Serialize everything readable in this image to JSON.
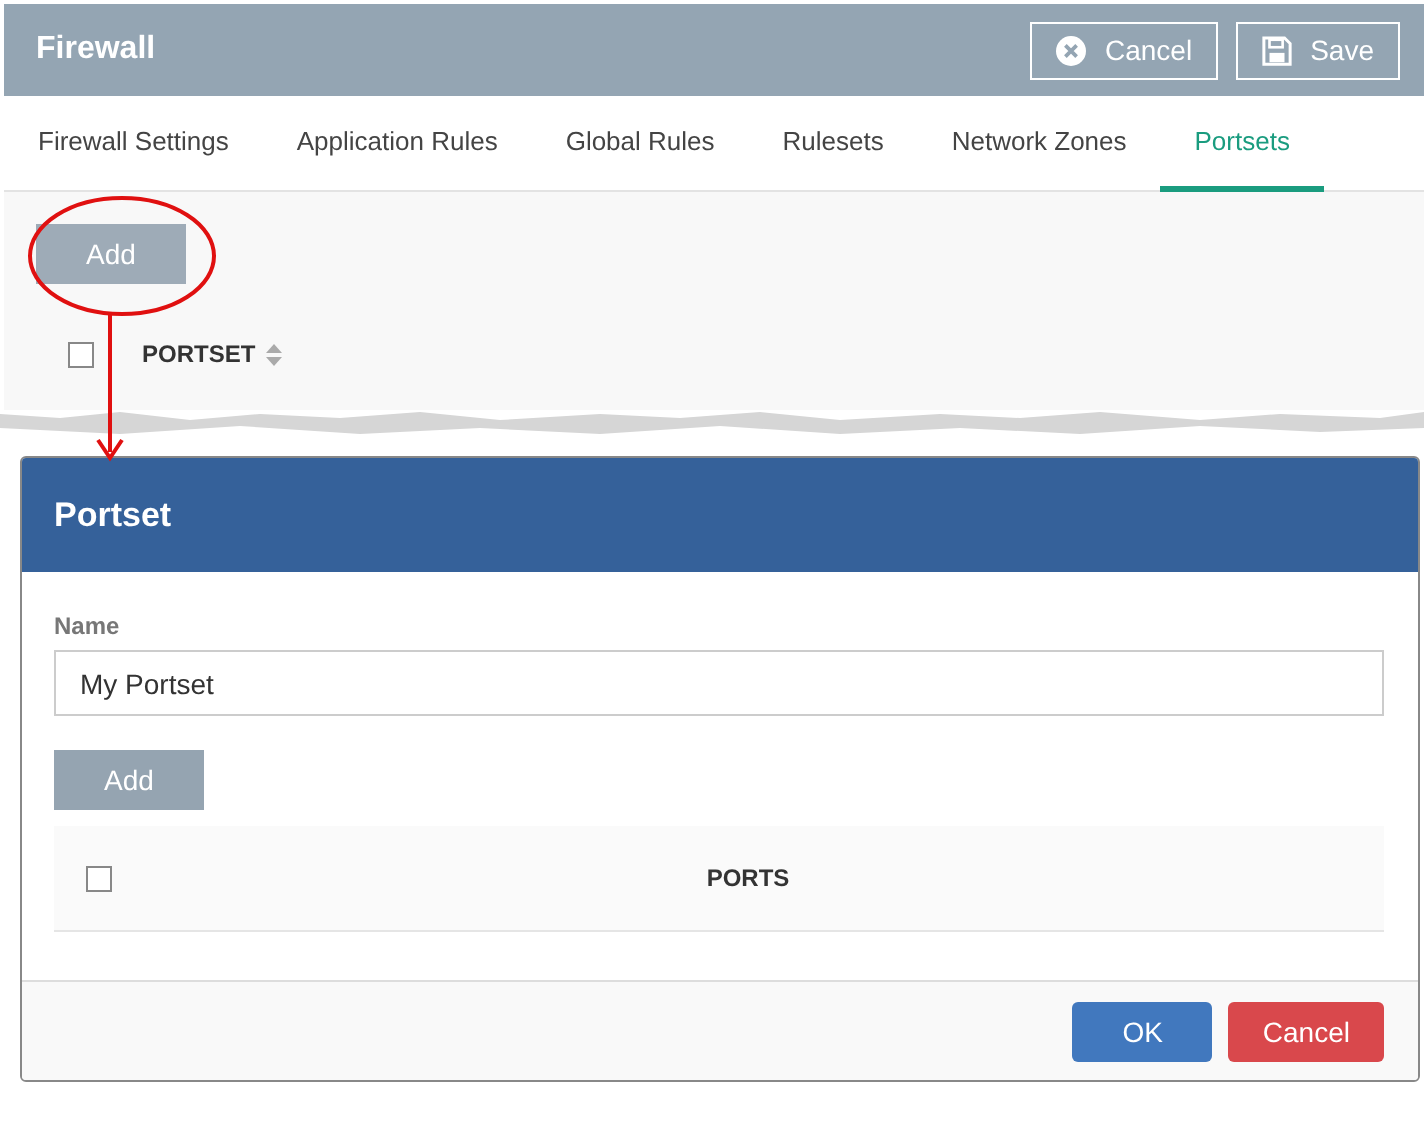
{
  "window": {
    "title": "Firewall"
  },
  "header_buttons": [
    {
      "label": "Cancel",
      "kind": "cancel"
    },
    {
      "label": "Save",
      "kind": "save"
    }
  ],
  "tabs": [
    {
      "label": "Firewall Settings",
      "selected": false
    },
    {
      "label": "Application Rules",
      "selected": false
    },
    {
      "label": "Global Rules",
      "selected": false
    },
    {
      "label": "Rulesets",
      "selected": false
    },
    {
      "label": "Network Zones",
      "selected": false
    },
    {
      "label": "Portsets",
      "selected": true
    }
  ],
  "toolbar": {
    "add_button": "Add"
  },
  "table": {
    "select_all_checked": false,
    "columns": [
      {
        "label": "PORTSET",
        "sortable": true
      }
    ]
  },
  "dialog": {
    "title": "Portset",
    "name_field": {
      "label": "Name",
      "value": "My Portset"
    },
    "add_button": "Add",
    "ports_table": {
      "select_all_checked": false,
      "columns": [
        {
          "label": "PORTS",
          "sortable": false
        }
      ]
    },
    "buttons": [
      {
        "label": "OK",
        "kind": "primary"
      },
      {
        "label": "Cancel",
        "kind": "danger"
      }
    ]
  }
}
